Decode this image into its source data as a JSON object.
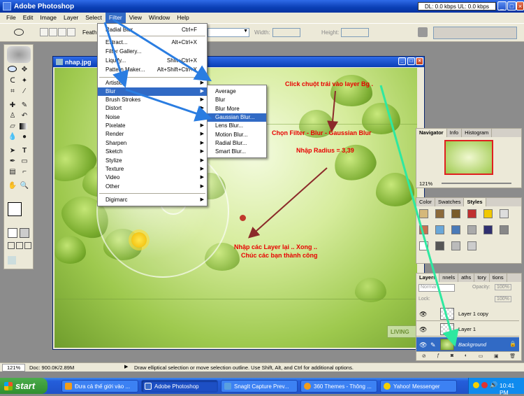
{
  "app": {
    "title": "Adobe Photoshop",
    "net_status": "DL: 0.0 kbps  UL: 0.0 kbps"
  },
  "menubar": [
    "File",
    "Edit",
    "Image",
    "Layer",
    "Select",
    "Filter",
    "View",
    "Window",
    "Help"
  ],
  "options": {
    "feather_label": "Feath",
    "width_label": "Width:",
    "height_label": "Height:"
  },
  "document": {
    "title": "nhap.jpg",
    "canvas_text": "LIVING"
  },
  "filter_menu": {
    "top": [
      {
        "label": "Radial Blur",
        "shortcut": "Ctrl+F"
      },
      {
        "label": "Extract...",
        "shortcut": "Alt+Ctrl+X"
      },
      {
        "label": "Filter Gallery...",
        "shortcut": ""
      },
      {
        "label": "Liquify...",
        "shortcut": "Shift+Ctrl+X"
      },
      {
        "label": "Pattern Maker...",
        "shortcut": "Alt+Shift+Ctrl+X"
      }
    ],
    "categories": [
      "Artistic",
      "Blur",
      "Brush Strokes",
      "Distort",
      "Noise",
      "Pixelate",
      "Render",
      "Sharpen",
      "Sketch",
      "Stylize",
      "Texture",
      "Video",
      "Other"
    ],
    "bottom": "Digimarc"
  },
  "blur_menu": [
    "Average",
    "Blur",
    "Blur More",
    "Gaussian Blur...",
    "Lens Blur...",
    "Motion Blur...",
    "Radial Blur...",
    "Smart Blur..."
  ],
  "annotations": {
    "a1": "Click chuột trái vào layer Bg .",
    "a2": "Chọn Filter - Blur - Gaussian Blur",
    "a3": "Nhập Radius = 3,39",
    "a4": "Nhập các Layer lại .. Xong ..",
    "a5": "Chúc các bạn thành công"
  },
  "navigator": {
    "tabs": [
      "Navigator",
      "Info",
      "Histogram"
    ],
    "zoom": "121%"
  },
  "styles_panel": {
    "tabs": [
      "Color",
      "Swatches",
      "Styles"
    ]
  },
  "layers_panel": {
    "tabs": [
      "Layers",
      "nnels",
      "aths",
      "tory",
      "tions"
    ],
    "blend_mode": "Normal",
    "opacity_label": "Opacity:",
    "opacity_value": "100%",
    "lock_label": "Lock:",
    "fill_value": "100%",
    "layers": [
      "Layer 1 copy",
      "Layer 1",
      "Background"
    ]
  },
  "statusbar": {
    "zoom": "121%",
    "doc": "Doc: 900.0K/2.89M",
    "hint": "Draw elliptical selection or move selection outline.  Use Shift, Alt, and Ctrl for additional options."
  },
  "taskbar": {
    "start": "start",
    "tasks": [
      "Đưa cả thế giới vào ...",
      "Adobe Photoshop",
      "SnagIt Capture Prev...",
      "360 Themes - Thông ...",
      "Yahoo! Messenger"
    ],
    "clock": "10:41 PM"
  }
}
